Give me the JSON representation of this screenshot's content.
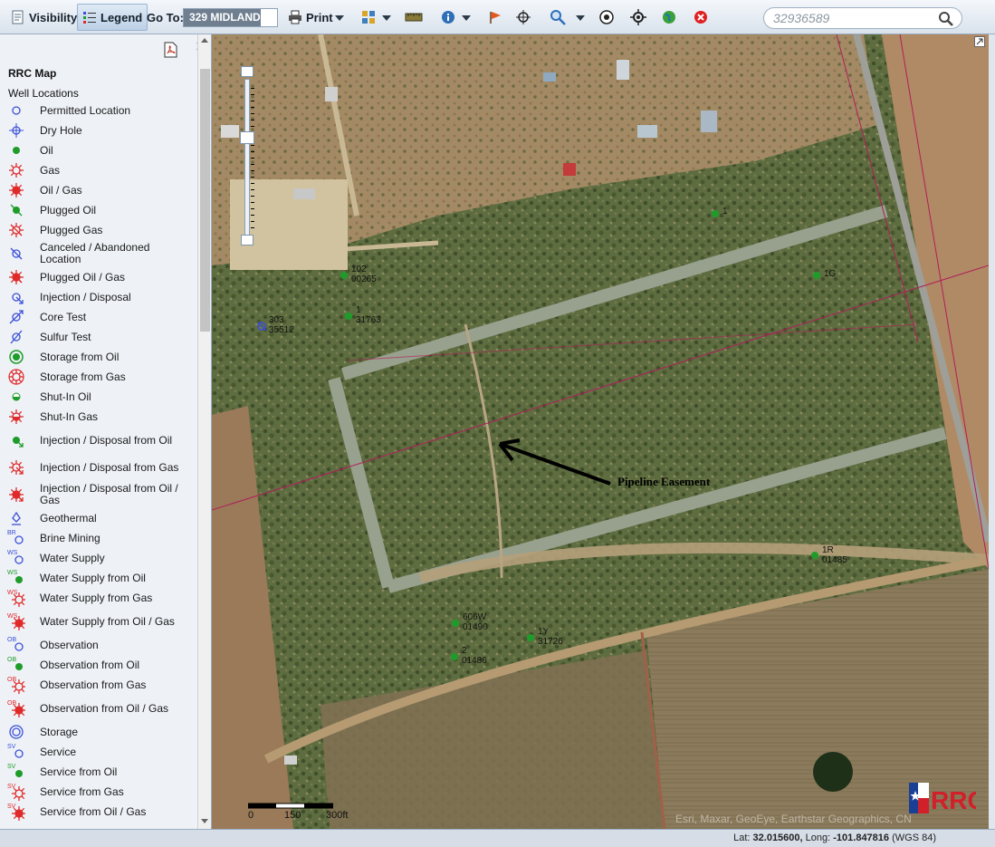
{
  "toolbar": {
    "visibility_label": "Visibility",
    "legend_label": "Legend",
    "goto_label": "Go To:",
    "goto_value": "329 MIDLAND",
    "print_label": "Print",
    "search_placeholder": "32936589",
    "icons": [
      "layers-icon",
      "legend-list-icon",
      "printer-icon",
      "grid-icon",
      "measure-icon",
      "info-icon",
      "flag-icon",
      "crosshair-icon",
      "zoom-icon",
      "target-icon",
      "locate-icon",
      "globe-icon",
      "close-red-icon",
      "search-icon"
    ]
  },
  "legend": {
    "title": "RRC Map",
    "subtitle": "Well Locations",
    "items": [
      {
        "label": "Permitted Location",
        "symbol": "open-circle",
        "color": "#3b4fd8"
      },
      {
        "label": "Dry Hole",
        "symbol": "circle-cross",
        "color": "#3b4fd8"
      },
      {
        "label": "Oil",
        "symbol": "dot",
        "color": "#1e9c2a"
      },
      {
        "label": "Gas",
        "symbol": "sun-open",
        "color": "#e02a2a"
      },
      {
        "label": "Oil / Gas",
        "symbol": "sun-filled",
        "color": "#e02a2a"
      },
      {
        "label": "Plugged Oil",
        "symbol": "dot-slash",
        "color": "#1e9c2a"
      },
      {
        "label": "Plugged Gas",
        "symbol": "sun-slash",
        "color": "#e02a2a"
      },
      {
        "label": "Canceled / Abandoned Location",
        "symbol": "circle-slash",
        "color": "#3b4fd8"
      },
      {
        "label": "Plugged Oil / Gas",
        "symbol": "sun-filled-slash",
        "color": "#e02a2a"
      },
      {
        "label": "Injection / Disposal",
        "symbol": "circle-arrow",
        "color": "#3b4fd8"
      },
      {
        "label": "Core Test",
        "symbol": "circle-arrow2",
        "color": "#3b4fd8"
      },
      {
        "label": "Sulfur Test",
        "symbol": "circle-slash2",
        "color": "#3b4fd8"
      },
      {
        "label": "Storage from Oil",
        "symbol": "ring-dot",
        "color": "#1e9c2a"
      },
      {
        "label": "Storage from Gas",
        "symbol": "ring-sun",
        "color": "#e02a2a"
      },
      {
        "label": "Shut-In Oil",
        "symbol": "half-dot",
        "color": "#1e9c2a"
      },
      {
        "label": "Shut-In Gas",
        "symbol": "sun-half",
        "color": "#e02a2a"
      },
      {
        "label": "Injection / Disposal from Oil",
        "symbol": "dot-arrow",
        "color": "#1e9c2a"
      },
      {
        "label": "Injection / Disposal from Gas",
        "symbol": "sun-arrow",
        "color": "#e02a2a"
      },
      {
        "label": "Injection / Disposal from Oil / Gas",
        "symbol": "sun-filled-arrow",
        "color": "#e02a2a"
      },
      {
        "label": "Geothermal",
        "symbol": "geo",
        "color": "#3b4fd8"
      },
      {
        "label": "Brine Mining",
        "symbol": "tag-circle",
        "color": "#3b4fd8",
        "tag": "BR"
      },
      {
        "label": "Water Supply",
        "symbol": "tag-circle",
        "color": "#3b4fd8",
        "tag": "WS"
      },
      {
        "label": "Water Supply from Oil",
        "symbol": "tag-dot",
        "color": "#1e9c2a",
        "tag": "WS"
      },
      {
        "label": "Water Supply from Gas",
        "symbol": "tag-sun",
        "color": "#e02a2a",
        "tag": "WS"
      },
      {
        "label": "Water Supply from Oil / Gas",
        "symbol": "tag-sun-filled",
        "color": "#e02a2a",
        "tag": "WS"
      },
      {
        "label": "Observation",
        "symbol": "tag-circle",
        "color": "#3b4fd8",
        "tag": "OB"
      },
      {
        "label": "Observation from Oil",
        "symbol": "tag-dot",
        "color": "#1e9c2a",
        "tag": "OB"
      },
      {
        "label": "Observation from Gas",
        "symbol": "tag-sun",
        "color": "#e02a2a",
        "tag": "OB"
      },
      {
        "label": "Observation from Oil / Gas",
        "symbol": "tag-sun-filled",
        "color": "#e02a2a",
        "tag": "OB"
      },
      {
        "label": "Storage",
        "symbol": "double-ring",
        "color": "#3b4fd8"
      },
      {
        "label": "Service",
        "symbol": "tag-circle",
        "color": "#3b4fd8",
        "tag": "SV"
      },
      {
        "label": "Service from Oil",
        "symbol": "tag-dot",
        "color": "#1e9c2a",
        "tag": "SV"
      },
      {
        "label": "Service from Gas",
        "symbol": "tag-sun",
        "color": "#e02a2a",
        "tag": "SV"
      },
      {
        "label": "Service from Oil / Gas",
        "symbol": "tag-sun-filled",
        "color": "#e02a2a",
        "tag": "SV"
      }
    ]
  },
  "map": {
    "wells": [
      {
        "label": "1",
        "type": "oil"
      },
      {
        "label": "1G",
        "type": "oil"
      },
      {
        "label": "102\n00265",
        "type": "oil"
      },
      {
        "label": "1\n31763",
        "type": "oil"
      },
      {
        "label": "303\n35512",
        "type": "injection"
      },
      {
        "label": "1R\n01485",
        "type": "oil"
      },
      {
        "label": "606W\n01490",
        "type": "oil"
      },
      {
        "label": "1Y\n31726",
        "type": "oil"
      },
      {
        "label": "2\n01486",
        "type": "oil"
      }
    ],
    "annotation": "Pipeline Easement",
    "scale_labels": [
      "0",
      "150",
      "300ft"
    ],
    "attribution": "Esri, Maxar, GeoEye, Earthstar Geographics, CN",
    "logo_text": "RRC"
  },
  "status": {
    "lat_label": "Lat:",
    "lat_value": "32.015600,",
    "long_label": "Long:",
    "long_value": "-101.847816",
    "datum": "(WGS 84)"
  },
  "colors": {
    "oil_green": "#1e9c2a",
    "gas_red": "#e02a2a",
    "location_blue": "#3b4fd8",
    "toolbar_bg": "#dfe6ee"
  }
}
